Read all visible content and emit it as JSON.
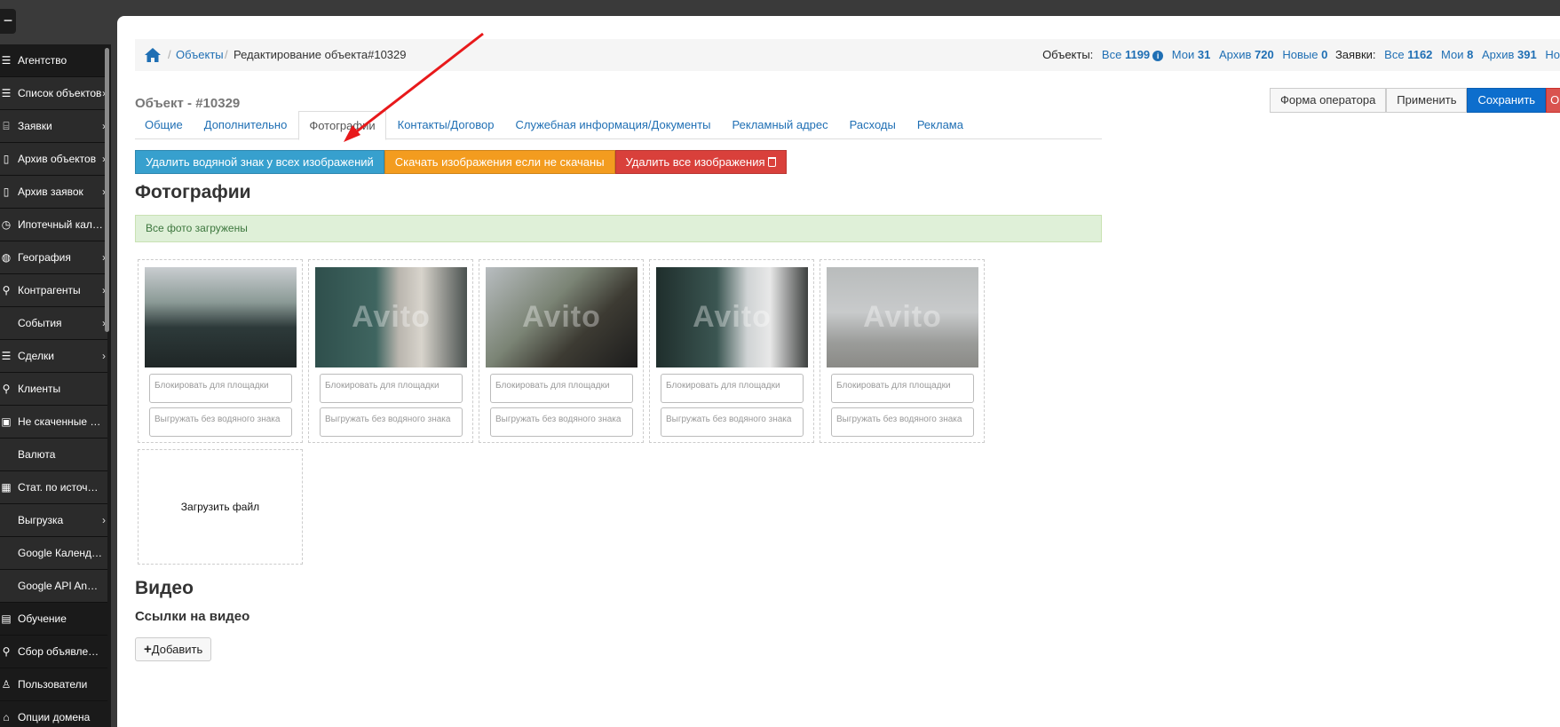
{
  "sidebar": {
    "toggle_icon": "minus-icon",
    "items": [
      {
        "label": "Агентство",
        "icon": "list-icon",
        "chevron": false
      },
      {
        "label": "Список объектов",
        "icon": "list-icon",
        "chevron": true
      },
      {
        "label": "Заявки",
        "icon": "bed-icon",
        "chevron": true
      },
      {
        "label": "Архив объектов",
        "icon": "trash-icon",
        "chevron": true
      },
      {
        "label": "Архив заявок",
        "icon": "trash-icon",
        "chevron": true
      },
      {
        "label": "Ипотечный калькулятор",
        "icon": "clock-icon",
        "chevron": false
      },
      {
        "label": "География",
        "icon": "globe-icon",
        "chevron": true
      },
      {
        "label": "Контрагенты",
        "icon": "search-icon",
        "chevron": true
      },
      {
        "label": "События",
        "icon": "",
        "chevron": true
      },
      {
        "label": "Сделки",
        "icon": "list-icon",
        "chevron": true
      },
      {
        "label": "Клиенты",
        "icon": "search-icon",
        "chevron": false
      },
      {
        "label": "Не скаченные фото",
        "icon": "image-icon",
        "chevron": false
      },
      {
        "label": "Валюта",
        "icon": "",
        "chevron": false
      },
      {
        "label": "Стат. по источникам",
        "icon": "grid-icon",
        "chevron": false
      },
      {
        "label": "Выгрузка",
        "icon": "",
        "chevron": true
      },
      {
        "label": "Google Календарь",
        "icon": "",
        "chevron": false
      },
      {
        "label": "Google API Analitics",
        "icon": "",
        "chevron": false
      },
      {
        "label": "Обучение",
        "icon": "book-icon",
        "chevron": false
      },
      {
        "label": "Сбор объявлений",
        "icon": "search-icon",
        "chevron": false
      },
      {
        "label": "Пользователи",
        "icon": "user-icon",
        "chevron": false
      },
      {
        "label": "Опции домена",
        "icon": "home-icon",
        "chevron": false
      }
    ]
  },
  "breadcrumb": {
    "home_icon": "home-icon",
    "objects": "Объекты",
    "current": "Редактирование объекта#10329"
  },
  "stats": {
    "objects_label": "Объекты:",
    "all_label": "Все",
    "all_count": "1199",
    "mine_label": "Мои",
    "mine_count": "31",
    "archive_label": "Архив",
    "archive_count": "720",
    "new_label": "Новые",
    "new_count": "0",
    "requests_label": "Заявки:",
    "req_all_label": "Все",
    "req_all_count": "1162",
    "req_mine_label": "Мои",
    "req_mine_count": "8",
    "req_archive_label": "Архив",
    "req_archive_count": "391",
    "req_new_label": "Но"
  },
  "object_title": "Объект - #10329",
  "actions": {
    "operator_form": "Форма оператора",
    "apply": "Применить",
    "save": "Сохранить",
    "cancel": "О"
  },
  "tabs": [
    {
      "label": "Общие",
      "active": false
    },
    {
      "label": "Дополнительно",
      "active": false
    },
    {
      "label": "Фотографии",
      "active": true
    },
    {
      "label": "Контакты/Договор",
      "active": false
    },
    {
      "label": "Служебная информация/Документы",
      "active": false
    },
    {
      "label": "Рекламный адрес",
      "active": false
    },
    {
      "label": "Расходы",
      "active": false
    },
    {
      "label": "Реклама",
      "active": false
    }
  ],
  "photo_buttons": {
    "remove_watermark": "Удалить водяной знак у всех изображений",
    "download_images": "Скачать изображения если не скачаны",
    "delete_all": "Удалить все изображения"
  },
  "photos_heading": "Фотографии",
  "alert_text": "Все фото загружены",
  "photos": [
    {
      "block_placeholder": "Блокировать для площадки",
      "nowm_placeholder": "Выгружать без водяного знака",
      "watermark": ""
    },
    {
      "block_placeholder": "Блокировать для площадки",
      "nowm_placeholder": "Выгружать без водяного знака",
      "watermark": "Avito"
    },
    {
      "block_placeholder": "Блокировать для площадки",
      "nowm_placeholder": "Выгружать без водяного знака",
      "watermark": "Avito"
    },
    {
      "block_placeholder": "Блокировать для площадки",
      "nowm_placeholder": "Выгружать без водяного знака",
      "watermark": "Avito"
    },
    {
      "block_placeholder": "Блокировать для площадки",
      "nowm_placeholder": "Выгружать без водяного знака",
      "watermark": "Avito"
    }
  ],
  "upload_label": "Загрузить файл",
  "video_heading": "Видео",
  "video_links_heading": "Ссылки на видео",
  "add_button": "Добавить",
  "colors": {
    "link": "#1f6fb4",
    "info": "#37a0ce",
    "warning": "#f39c1f",
    "danger": "#d9403b",
    "primary": "#0d6ecd",
    "success_bg": "#dff0d8",
    "arrow": "#e8191b"
  }
}
